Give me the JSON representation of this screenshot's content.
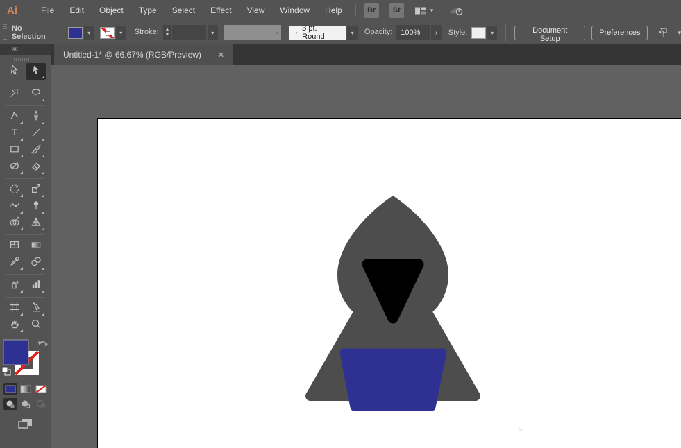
{
  "app": {
    "logo_text": "Ai"
  },
  "menubar": {
    "menus": [
      "File",
      "Edit",
      "Object",
      "Type",
      "Select",
      "Effect",
      "View",
      "Window",
      "Help"
    ],
    "bridge_button": "Br",
    "stock_button": "St"
  },
  "controlbar": {
    "selection_status": "No Selection",
    "stroke_label": "Stroke:",
    "brush_bullet": "•",
    "brush_preset": "3 pt. Round",
    "opacity_label": "Opacity:",
    "opacity_value": "100%",
    "opacity_arrow": "›",
    "style_label": "Style:",
    "document_setup_button": "Document Setup",
    "preferences_button": "Preferences"
  },
  "tabbar": {
    "active_tab": {
      "title": "Untitled-1* @ 66.67% (RGB/Preview)",
      "close_glyph": "✕"
    }
  },
  "toolbar": {
    "collapse_glyph": "««",
    "active_tool": "direct-selection-tool",
    "tools": [
      "selection-tool",
      "direct-selection-tool",
      "sep",
      "magic-wand-tool",
      "lasso-tool",
      "sep2",
      "curvature-tool",
      "pen-tool",
      "type-tool",
      "line-segment-tool",
      "rectangle-tool",
      "paintbrush-tool",
      "shaper-tool",
      "eraser-tool",
      "sep3",
      "rotate-tool",
      "scale-tool",
      "width-tool",
      "puppet-warp-tool",
      "shape-builder-tool",
      "perspective-grid-tool",
      "sep4",
      "mesh-tool",
      "gradient-tool",
      "eyedropper-tool",
      "blend-tool",
      "sep5",
      "symbol-sprayer-tool",
      "column-graph-tool",
      "sep6",
      "artboard-tool",
      "slice-tool",
      "hand-tool",
      "zoom-tool"
    ]
  },
  "colors": {
    "fill_swatch": "#2e3192",
    "stroke_none_red": "#e0201b",
    "artwork_gray": "#4d4d4d",
    "artwork_black": "#000000",
    "artwork_blue": "#2e3192",
    "pasteboard": "#616161",
    "artboard_white": "#ffffff"
  },
  "icons": [
    "workspace-switcher-icon",
    "gpu-performance-icon",
    "chevron-down-icon",
    "swap-fill-stroke-icon",
    "default-fill-stroke-icon",
    "color-button-icon",
    "gradient-button-icon",
    "none-button-icon",
    "draw-normal-icon",
    "draw-behind-icon",
    "draw-inside-icon",
    "screen-mode-icon",
    "select-similar-options-icon",
    "close-icon"
  ]
}
